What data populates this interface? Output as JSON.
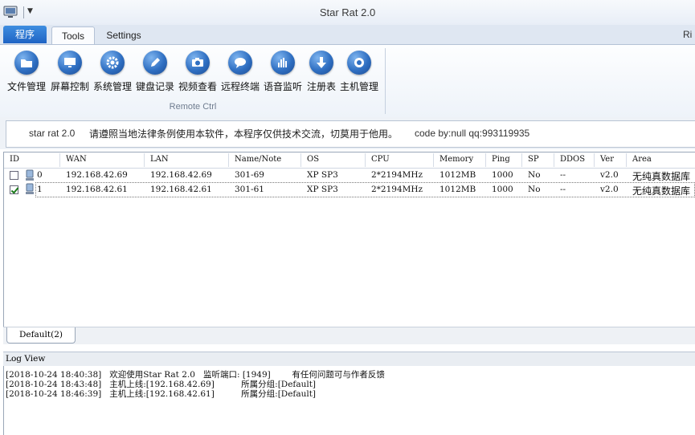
{
  "window": {
    "title": "Star Rat 2.0"
  },
  "tabs": {
    "program": "程序",
    "tools": "Tools",
    "settings": "Settings",
    "right_cut": "Ri"
  },
  "ribbon": {
    "group_label": "Remote Ctrl",
    "buttons": [
      {
        "label": "文件管理",
        "icon": "folder-icon"
      },
      {
        "label": "屏幕控制",
        "icon": "monitor-icon"
      },
      {
        "label": "系统管理",
        "icon": "gear-icon"
      },
      {
        "label": "键盘记录",
        "icon": "pencil-icon"
      },
      {
        "label": "视频查看",
        "icon": "camera-icon"
      },
      {
        "label": "远程终端",
        "icon": "chat-bubble-icon"
      },
      {
        "label": "语音监听",
        "icon": "equalizer-icon"
      },
      {
        "label": "注册表",
        "icon": "download-arrow-icon"
      },
      {
        "label": "主机管理",
        "icon": "badge-icon"
      }
    ]
  },
  "banner": {
    "name": "star rat 2.0",
    "notice": "请遵照当地法律条例使用本软件，本程序仅供技术交流，切莫用于他用。",
    "credit": "code by:null qq:993119935"
  },
  "hosts": {
    "columns": [
      "ID",
      "WAN",
      "LAN",
      "Name/Note",
      "OS",
      "CPU",
      "Memory",
      "Ping",
      "SP",
      "DDOS",
      "Ver",
      "Area"
    ],
    "rows": [
      {
        "checked": false,
        "id": "0",
        "wan": "192.168.42.69",
        "lan": "192.168.42.69",
        "name": "301-69",
        "os": "XP SP3",
        "cpu": "2*2194MHz",
        "memory": "1012MB",
        "ping": "1000",
        "sp": "No",
        "ddos": "--",
        "ver": "v2.0",
        "area": "无纯真数据库"
      },
      {
        "checked": true,
        "id": "1",
        "wan": "192.168.42.61",
        "lan": "192.168.42.61",
        "name": "301-61",
        "os": "XP SP3",
        "cpu": "2*2194MHz",
        "memory": "1012MB",
        "ping": "1000",
        "sp": "No",
        "ddos": "--",
        "ver": "v2.0",
        "area": "无纯真数据库"
      }
    ]
  },
  "group_tab": {
    "label": "Default(2)"
  },
  "log": {
    "title": "Log View",
    "lines": [
      "[2018-10-24 18:40:38]   欢迎使用Star Rat 2.0   监听端口: [1949]        有任何问题可与作者反馈",
      "[2018-10-24 18:43:48]   主机上线:[192.168.42.69]          所属分组:[Default]",
      "[2018-10-24 18:46:39]   主机上线:[192.168.42.61]          所属分组:[Default]"
    ]
  },
  "colors": {
    "accent": "#1f63c4",
    "ribbon_bg": "#eef3f9"
  }
}
